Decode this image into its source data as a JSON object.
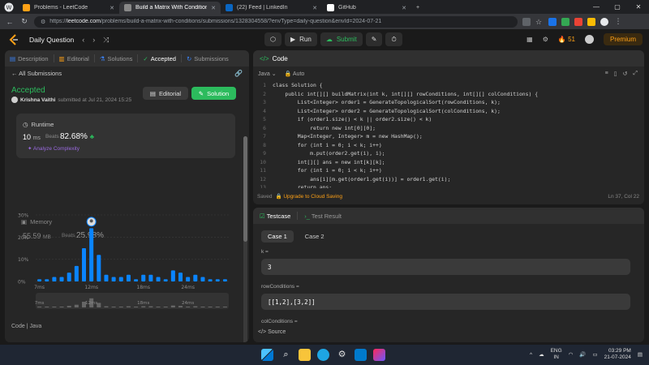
{
  "browser": {
    "tabs": [
      {
        "title": "Problems - LeetCode",
        "color": "#ffa116",
        "active": false
      },
      {
        "title": "Build a Matrix With Conditions -",
        "color": "#888888",
        "active": true
      },
      {
        "title": "(22) Feed | LinkedIn",
        "color": "#0a66c2",
        "active": false
      },
      {
        "title": "GitHub",
        "color": "#ffffff",
        "active": false
      }
    ],
    "new_tab": "+",
    "url_host": "leetcode.com",
    "url_prefix": "https://",
    "url_rest": "/problems/build-a-matrix-with-conditions/submissions/1328304558/?envType=daily-question&envId=2024-07-21"
  },
  "header": {
    "title": "Daily Question",
    "run_label": "Run",
    "submit_label": "Submit",
    "streak": "51",
    "premium_label": "Premium"
  },
  "left": {
    "tabs": [
      "Description",
      "Editorial",
      "Solutions",
      "Accepted",
      "Submissions"
    ],
    "all_submissions": "All Submissions",
    "status": "Accepted",
    "author": "Krishna Vaithi",
    "submitted": "submitted at Jul 21, 2024 15:25",
    "editorial_btn": "Editorial",
    "solution_btn": "Solution",
    "runtime": {
      "label": "Runtime",
      "value": "10",
      "unit": "ms",
      "beats_label": "Beats",
      "beats_pct": "82.68%",
      "analyze": "Analyze Complexity"
    },
    "memory": {
      "label": "Memory",
      "value": "55.59",
      "unit": "MB",
      "beats_label": "Beats",
      "beats_pct": "25.98%"
    },
    "code_lang": "Code  |  Java"
  },
  "chart_data": {
    "type": "bar",
    "ylim": [
      0,
      30
    ],
    "yticks": [
      "30%",
      "20%",
      "10%",
      "0%"
    ],
    "xticks": [
      "7ms",
      "12ms",
      "18ms",
      "24ms"
    ],
    "values": [
      1,
      1,
      2,
      2,
      4,
      7,
      15,
      24,
      12,
      3,
      2,
      2,
      3,
      1,
      3,
      3,
      2,
      1,
      5,
      4,
      2,
      3,
      2,
      1,
      1,
      1
    ],
    "highlight_index": 7,
    "color": "#0a84ff",
    "grid": true
  },
  "code": {
    "title": "Code",
    "language": "Java",
    "mode": "Auto",
    "lines": [
      "class Solution {",
      "    public int[][] buildMatrix(int k, int[][] rowConditions, int[][] colConditions) {",
      "        List<Integer> order1 = GenerateTopologicalSort(rowConditions, k);",
      "        List<Integer> order2 = GenerateTopologicalSort(colConditions, k);",
      "        if (order1.size() < k || order2.size() < k)",
      "            return new int[0][0];",
      "        Map<Integer, Integer> m = new HashMap();",
      "        for (int i = 0; i < k; i++)",
      "            m.put(order2.get(i), i);",
      "        int[][] ans = new int[k][k];",
      "        for (int i = 0; i < k; i++)",
      "            ans[i][m.get(order1.get(i))] = order1.get(i);",
      "        return ans;"
    ],
    "saved": "Saved",
    "upgrade": "Upgrade to Cloud Saving",
    "position": "Ln 37, Col 22"
  },
  "testcase": {
    "tab1": "Testcase",
    "tab2": "Test Result",
    "cases": [
      "Case 1",
      "Case 2"
    ],
    "params": [
      {
        "label": "k =",
        "value": "3"
      },
      {
        "label": "rowConditions =",
        "value": "[[1,2],[3,2]]"
      },
      {
        "label": "colConditions =",
        "value": ""
      }
    ],
    "source": "Source"
  },
  "taskbar": {
    "lang1": "ENG",
    "lang2": "IN",
    "time": "03:29 PM",
    "date": "21-07-2024"
  }
}
